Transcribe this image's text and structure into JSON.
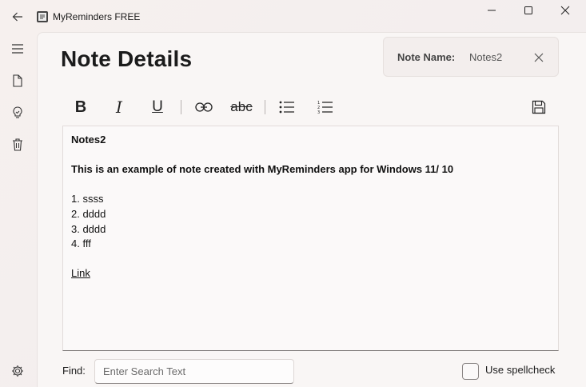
{
  "app": {
    "title": "MyReminders FREE"
  },
  "nav": {
    "items": [
      {
        "icon": "hamburger-menu-icon"
      },
      {
        "icon": "document-icon"
      },
      {
        "icon": "lightbulb-icon"
      },
      {
        "icon": "trash-icon"
      },
      {
        "icon": "gear-icon"
      }
    ]
  },
  "page": {
    "title": "Note Details"
  },
  "note_name": {
    "label": "Note Name:",
    "value": "Notes2"
  },
  "toolbar": {
    "bold": "B",
    "italic": "I",
    "underline": "U",
    "strikethrough": "abc"
  },
  "editor": {
    "title": "Notes2",
    "heading": "This is an example of note created with MyReminders app for Windows 11/ 10",
    "list": [
      "1. ssss",
      "2. dddd",
      "3. dddd",
      "4. fff"
    ],
    "link": "Link"
  },
  "find": {
    "label": "Find:",
    "placeholder": "Enter Search Text",
    "value": ""
  },
  "spellcheck": {
    "label": "Use spellcheck",
    "checked": false
  }
}
